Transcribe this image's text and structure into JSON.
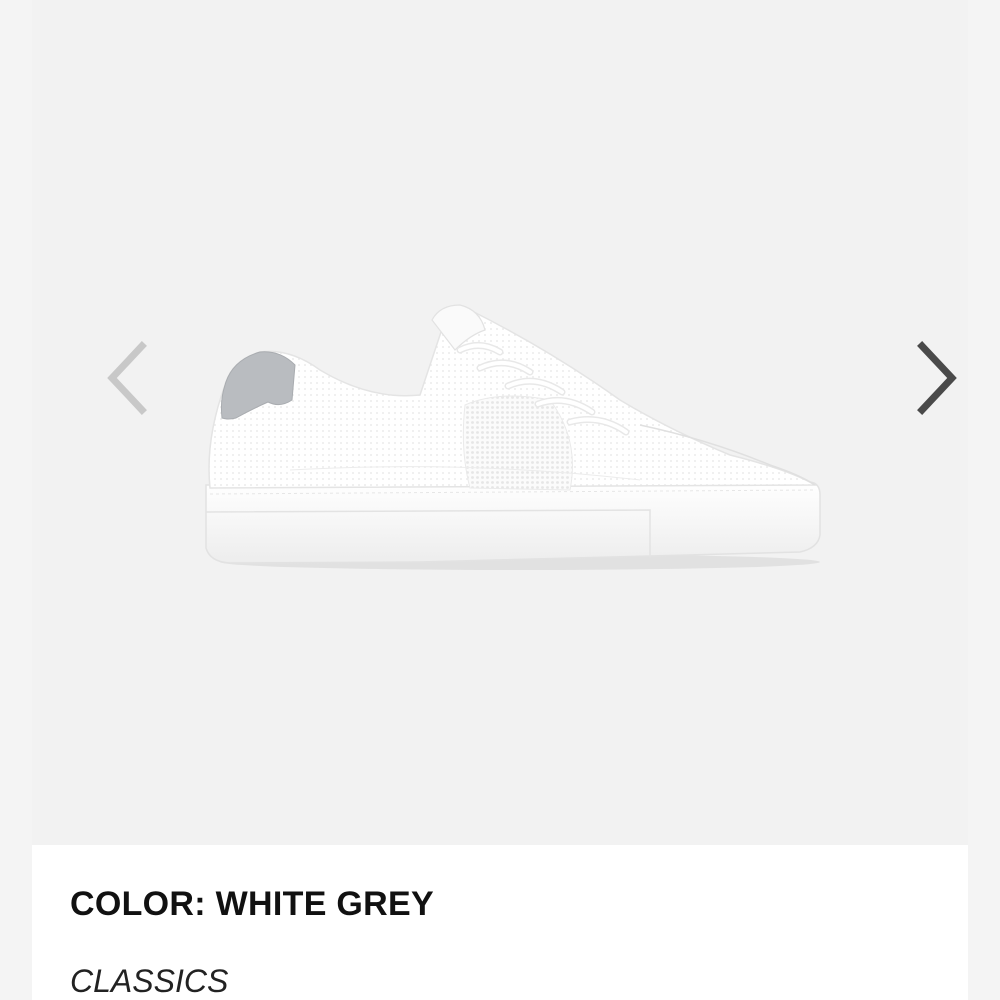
{
  "product": {
    "color_label": "COLOR: WHITE GREY",
    "collection": "CLASSICS"
  },
  "gallery": {
    "image_alt": "White knit low-top sneaker with grey heel tab",
    "prev_icon": "chevron-left-icon",
    "next_icon": "chevron-right-icon"
  },
  "colors": {
    "background": "#f4f4f4",
    "panel": "#ffffff",
    "text": "#111111",
    "prev_arrow": "#c8c8c8",
    "next_arrow": "#4a4a4a",
    "heel_tab": "#b9bcc0"
  }
}
